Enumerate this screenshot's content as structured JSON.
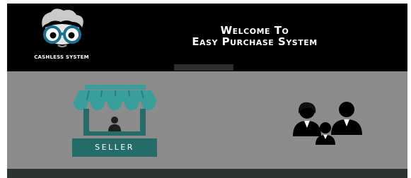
{
  "header": {
    "logo_text": "CASHLESS SYSTEM",
    "title_line1": "Welcome To",
    "title_line2": "Easy Purchase System"
  },
  "main": {
    "seller_label": "SELLER",
    "seller_icon": "market-stall-icon",
    "buyer_icon": "people-group-icon"
  },
  "colors": {
    "header_bg": "#000000",
    "main_bg": "#8c8c8c",
    "accent_teal": "#256b68",
    "awning_teal": "#3a9e9b",
    "footer_bg": "#2d3533"
  }
}
